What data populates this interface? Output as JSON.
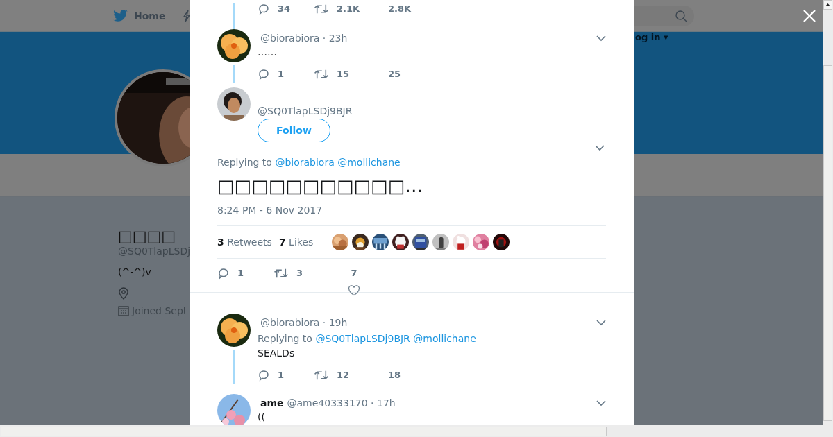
{
  "nav": {
    "home": "Home",
    "login": "og in ▾"
  },
  "profile": {
    "name": "□□□□",
    "handle": "@SQ0TlapLSDj",
    "bio": "(^-^)v",
    "joined": "Joined Sept"
  },
  "thread": [
    {
      "kind": "actions",
      "threaded": true,
      "replies": "34",
      "retweets": "2.1K",
      "likes": "2.8K"
    },
    {
      "kind": "tweet",
      "threaded": true,
      "meta": "@biorabiora · 23h",
      "text": "……",
      "replies": "1",
      "retweets": "15",
      "likes": "25"
    }
  ],
  "main_tweet": {
    "handle": "@SQ0TlapLSDj9BJR",
    "follow": "Follow",
    "replying_label": "Replying to",
    "replying_to": [
      "@biorabiora",
      "@mollichane"
    ],
    "text": "□□□□□□□□□□□…",
    "timestamp": "8:24 PM - 6 Nov 2017",
    "retweets_stat": "**3** Retweets",
    "likes_stat": "**7** Likes",
    "replies": "1",
    "retweets": "3",
    "likes": "7"
  },
  "replies": [
    {
      "kind": "tweet",
      "threaded": true,
      "meta": "@biorabiora · 19h",
      "replying_label": "Replying to",
      "replying_to": [
        "@SQ0TlapLSDj9BJR",
        "@mollichane"
      ],
      "text": "SEALDs",
      "replies": "1",
      "retweets": "12",
      "likes": "18"
    },
    {
      "kind": "tweet",
      "threaded": false,
      "name": "ame",
      "meta": "@ame40333170 · 17h",
      "text": "((_"
    }
  ]
}
